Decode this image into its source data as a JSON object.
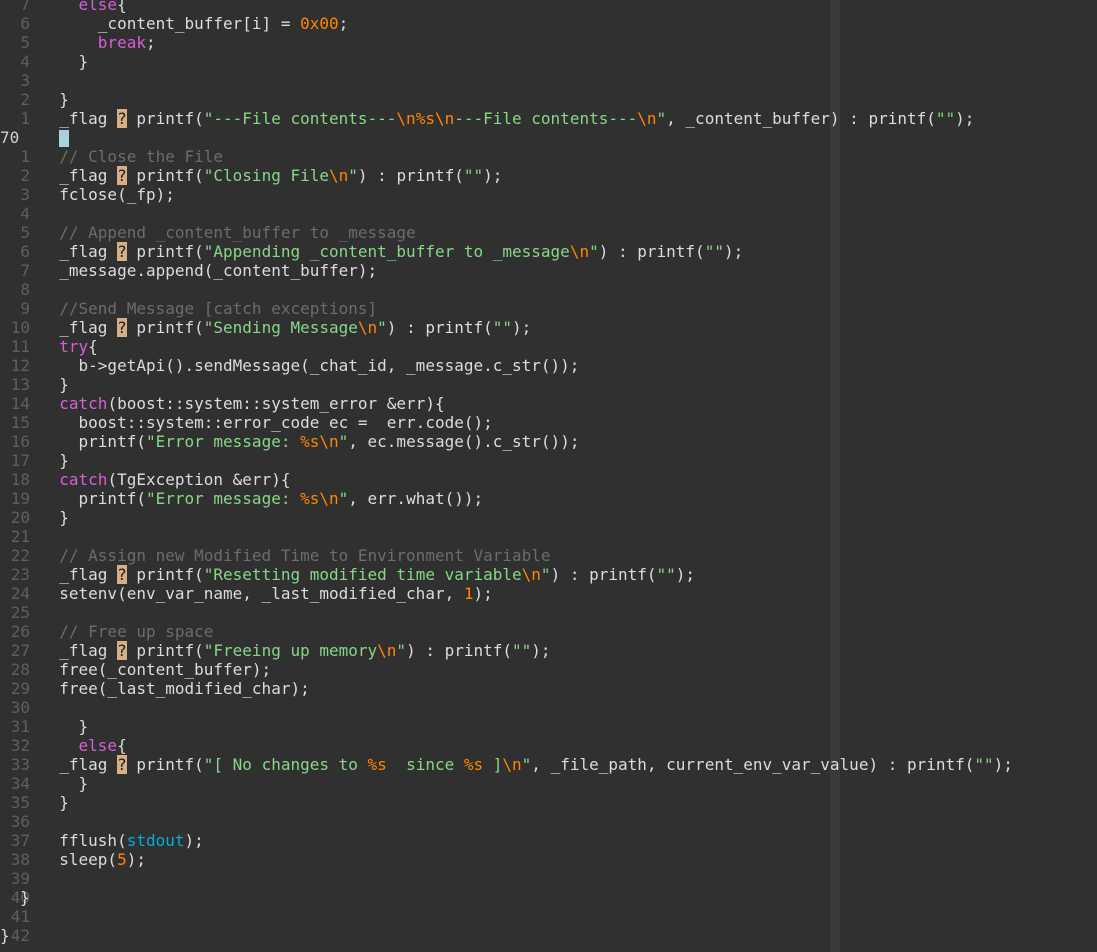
{
  "editor": {
    "cursor_line_number": "70",
    "lines": [
      {
        "n": "7",
        "t": [
          {
            "s": "    "
          },
          {
            "s": "else",
            "c": "kw"
          },
          {
            "s": "{"
          }
        ]
      },
      {
        "n": "6",
        "t": [
          {
            "s": "      _content_buffer[i] = "
          },
          {
            "s": "0x00",
            "c": "num"
          },
          {
            "s": ";"
          }
        ]
      },
      {
        "n": "5",
        "t": [
          {
            "s": "      "
          },
          {
            "s": "break",
            "c": "kw"
          },
          {
            "s": ";"
          }
        ]
      },
      {
        "n": "4",
        "t": [
          {
            "s": "    }"
          }
        ]
      },
      {
        "n": "3",
        "t": []
      },
      {
        "n": "2",
        "t": [
          {
            "s": "  }"
          }
        ]
      },
      {
        "n": "1",
        "t": [
          {
            "s": "  _flag "
          },
          {
            "s": "?",
            "c": "q"
          },
          {
            "s": " printf("
          },
          {
            "s": "\"---File contents---",
            "c": "str"
          },
          {
            "s": "\\n",
            "c": "esc"
          },
          {
            "s": "%s",
            "c": "esc"
          },
          {
            "s": "\\n",
            "c": "esc"
          },
          {
            "s": "---File contents---",
            "c": "str"
          },
          {
            "s": "\\n",
            "c": "esc"
          },
          {
            "s": "\"",
            "c": "str"
          },
          {
            "s": ", _content_buffer) : printf("
          },
          {
            "s": "\"\"",
            "c": "str"
          },
          {
            "s": ");"
          }
        ]
      },
      {
        "n": "70",
        "current": true,
        "t": [
          {
            "s": "  "
          },
          {
            "s": "",
            "c": "cursor"
          }
        ]
      },
      {
        "n": "1",
        "t": [
          {
            "s": "  "
          },
          {
            "s": "// Close the File",
            "c": "cm"
          }
        ]
      },
      {
        "n": "2",
        "t": [
          {
            "s": "  _flag "
          },
          {
            "s": "?",
            "c": "q"
          },
          {
            "s": " printf("
          },
          {
            "s": "\"Closing File",
            "c": "str"
          },
          {
            "s": "\\n",
            "c": "esc"
          },
          {
            "s": "\"",
            "c": "str"
          },
          {
            "s": ") : printf("
          },
          {
            "s": "\"\"",
            "c": "str"
          },
          {
            "s": ");"
          }
        ]
      },
      {
        "n": "3",
        "t": [
          {
            "s": "  fclose(_fp);"
          }
        ]
      },
      {
        "n": "4",
        "t": []
      },
      {
        "n": "5",
        "t": [
          {
            "s": "  "
          },
          {
            "s": "// Append _content_buffer to _message",
            "c": "cm"
          }
        ]
      },
      {
        "n": "6",
        "t": [
          {
            "s": "  _flag "
          },
          {
            "s": "?",
            "c": "q"
          },
          {
            "s": " printf("
          },
          {
            "s": "\"Appending _content_buffer to _message",
            "c": "str"
          },
          {
            "s": "\\n",
            "c": "esc"
          },
          {
            "s": "\"",
            "c": "str"
          },
          {
            "s": ") : printf("
          },
          {
            "s": "\"\"",
            "c": "str"
          },
          {
            "s": ");"
          }
        ]
      },
      {
        "n": "7",
        "t": [
          {
            "s": "  _message.append(_content_buffer);"
          }
        ]
      },
      {
        "n": "8",
        "t": []
      },
      {
        "n": "9",
        "t": [
          {
            "s": "  "
          },
          {
            "s": "//Send Message [catch exceptions]",
            "c": "cm"
          }
        ]
      },
      {
        "n": "10",
        "t": [
          {
            "s": "  _flag "
          },
          {
            "s": "?",
            "c": "q"
          },
          {
            "s": " printf("
          },
          {
            "s": "\"Sending Message",
            "c": "str"
          },
          {
            "s": "\\n",
            "c": "esc"
          },
          {
            "s": "\"",
            "c": "str"
          },
          {
            "s": ") : printf("
          },
          {
            "s": "\"\"",
            "c": "str"
          },
          {
            "s": ");"
          }
        ]
      },
      {
        "n": "11",
        "t": [
          {
            "s": "  "
          },
          {
            "s": "try",
            "c": "kw"
          },
          {
            "s": "{"
          }
        ]
      },
      {
        "n": "12",
        "t": [
          {
            "s": "    b->getApi().sendMessage(_chat_id, _message.c_str());"
          }
        ]
      },
      {
        "n": "13",
        "t": [
          {
            "s": "  }"
          }
        ]
      },
      {
        "n": "14",
        "t": [
          {
            "s": "  "
          },
          {
            "s": "catch",
            "c": "kw"
          },
          {
            "s": "(boost::system::system_error &err){"
          }
        ]
      },
      {
        "n": "15",
        "t": [
          {
            "s": "    boost::system::error_code ec =  err.code();"
          }
        ]
      },
      {
        "n": "16",
        "t": [
          {
            "s": "    printf("
          },
          {
            "s": "\"Error message: ",
            "c": "str"
          },
          {
            "s": "%s",
            "c": "esc"
          },
          {
            "s": "\\n",
            "c": "esc"
          },
          {
            "s": "\"",
            "c": "str"
          },
          {
            "s": ", ec.message().c_str());"
          }
        ]
      },
      {
        "n": "17",
        "t": [
          {
            "s": "  }"
          }
        ]
      },
      {
        "n": "18",
        "t": [
          {
            "s": "  "
          },
          {
            "s": "catch",
            "c": "kw"
          },
          {
            "s": "(TgException &err){"
          }
        ]
      },
      {
        "n": "19",
        "t": [
          {
            "s": "    printf("
          },
          {
            "s": "\"Error message: ",
            "c": "str"
          },
          {
            "s": "%s",
            "c": "esc"
          },
          {
            "s": "\\n",
            "c": "esc"
          },
          {
            "s": "\"",
            "c": "str"
          },
          {
            "s": ", err.what());"
          }
        ]
      },
      {
        "n": "20",
        "t": [
          {
            "s": "  }"
          }
        ]
      },
      {
        "n": "21",
        "t": []
      },
      {
        "n": "22",
        "t": [
          {
            "s": "  "
          },
          {
            "s": "// Assign new Modified Time to Environment Variable",
            "c": "cm"
          }
        ]
      },
      {
        "n": "23",
        "t": [
          {
            "s": "  _flag "
          },
          {
            "s": "?",
            "c": "q"
          },
          {
            "s": " printf("
          },
          {
            "s": "\"Resetting modified time variable",
            "c": "str"
          },
          {
            "s": "\\n",
            "c": "esc"
          },
          {
            "s": "\"",
            "c": "str"
          },
          {
            "s": ") : printf("
          },
          {
            "s": "\"\"",
            "c": "str"
          },
          {
            "s": ");"
          }
        ]
      },
      {
        "n": "24",
        "t": [
          {
            "s": "  setenv(env_var_name, _last_modified_char, "
          },
          {
            "s": "1",
            "c": "num"
          },
          {
            "s": ");"
          }
        ]
      },
      {
        "n": "25",
        "t": []
      },
      {
        "n": "26",
        "t": [
          {
            "s": "  "
          },
          {
            "s": "// Free up space",
            "c": "cm"
          }
        ]
      },
      {
        "n": "27",
        "t": [
          {
            "s": "  _flag "
          },
          {
            "s": "?",
            "c": "q"
          },
          {
            "s": " printf("
          },
          {
            "s": "\"Freeing up memory",
            "c": "str"
          },
          {
            "s": "\\n",
            "c": "esc"
          },
          {
            "s": "\"",
            "c": "str"
          },
          {
            "s": ") : printf("
          },
          {
            "s": "\"\"",
            "c": "str"
          },
          {
            "s": ");"
          }
        ]
      },
      {
        "n": "28",
        "t": [
          {
            "s": "  free(_content_buffer);"
          }
        ]
      },
      {
        "n": "29",
        "t": [
          {
            "s": "  free(_last_modified_char);"
          }
        ]
      },
      {
        "n": "30",
        "t": []
      },
      {
        "n": "31",
        "t": [
          {
            "s": "    }"
          }
        ]
      },
      {
        "n": "32",
        "t": [
          {
            "s": "    "
          },
          {
            "s": "else",
            "c": "kw"
          },
          {
            "s": "{"
          }
        ]
      },
      {
        "n": "33",
        "t": [
          {
            "s": "  _flag "
          },
          {
            "s": "?",
            "c": "q"
          },
          {
            "s": " printf("
          },
          {
            "s": "\"[ No changes to ",
            "c": "str"
          },
          {
            "s": "%s",
            "c": "esc"
          },
          {
            "s": "  since ",
            "c": "str"
          },
          {
            "s": "%s",
            "c": "esc"
          },
          {
            "s": " ]",
            "c": "str"
          },
          {
            "s": "\\n",
            "c": "esc"
          },
          {
            "s": "\"",
            "c": "str"
          },
          {
            "s": ", _file_path, current_env_var_value) : printf("
          },
          {
            "s": "\"\"",
            "c": "str"
          },
          {
            "s": ");"
          }
        ]
      },
      {
        "n": "34",
        "t": [
          {
            "s": "    }"
          }
        ]
      },
      {
        "n": "35",
        "t": [
          {
            "s": "  }"
          }
        ]
      },
      {
        "n": "36",
        "t": []
      },
      {
        "n": "37",
        "t": [
          {
            "s": "  fflush("
          },
          {
            "s": "stdout",
            "c": "cy"
          },
          {
            "s": ");"
          }
        ]
      },
      {
        "n": "38",
        "t": [
          {
            "s": "  sleep("
          },
          {
            "s": "5",
            "c": "num"
          },
          {
            "s": ");"
          }
        ]
      },
      {
        "n": "39",
        "t": []
      },
      {
        "n": "40",
        "t": [
          {
            "s": "}"
          }
        ]
      },
      {
        "n": "41",
        "t": []
      },
      {
        "n": "42",
        "t": [
          {
            "s": "}"
          }
        ]
      }
    ]
  }
}
